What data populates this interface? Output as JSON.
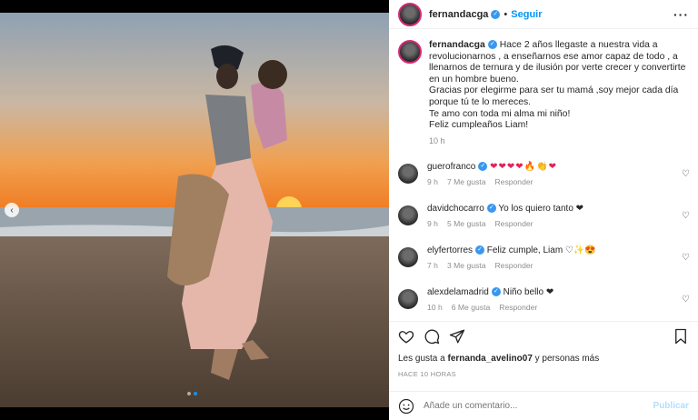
{
  "header": {
    "username": "fernandacga",
    "follow_label": "Seguir",
    "more_label": "···"
  },
  "caption": {
    "username": "fernandacga",
    "lines": [
      "Hace 2 años llegaste a nuestra vida a",
      "revolucionarnos , a enseñarnos ese amor capaz de todo , a",
      "llenarnos de ternura y de ilusión por verte crecer y convertirte",
      "en un hombre bueno.",
      "Gracias por elegirme para ser tu mamá ,soy mejor cada día",
      "porque tú te lo mereces.",
      "Te amo con toda mi alma mi niño!",
      "Feliz cumpleaños Liam!"
    ],
    "time": "10 h"
  },
  "comments": [
    {
      "username": "guerofranco",
      "text": "❤❤❤❤🔥👏❤",
      "time": "9 h",
      "likes": "7 Me gusta",
      "reply": "Responder"
    },
    {
      "username": "davidchocarro",
      "text": "Yo los quiero tanto ❤",
      "time": "9 h",
      "likes": "5 Me gusta",
      "reply": "Responder"
    },
    {
      "username": "elyfertorres",
      "text": "Feliz cumple, Liam ♡✨😍",
      "time": "7 h",
      "likes": "3 Me gusta",
      "reply": "Responder"
    },
    {
      "username": "alexdelamadrid",
      "text": "Niño bello ❤",
      "time": "10 h",
      "likes": "6 Me gusta",
      "reply": "Responder"
    }
  ],
  "likes": {
    "prefix": "Les gusta a",
    "user": "fernanda_avelino07",
    "suffix": "y personas más"
  },
  "post_date": "HACE 10 HORAS",
  "add_comment": {
    "placeholder": "Añade un comentario...",
    "publish_label": "Publicar"
  },
  "colors": {
    "accent": "#0095f6",
    "verified": "#3897f0",
    "heart": "#e0245e"
  },
  "carousel": {
    "total": 2,
    "active": 2
  }
}
